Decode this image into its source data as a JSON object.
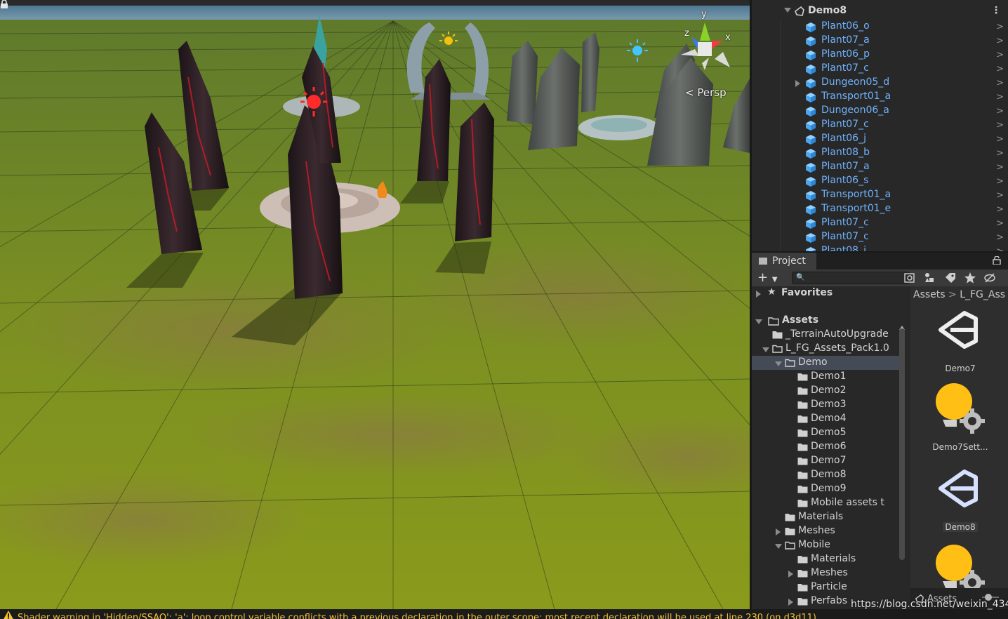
{
  "scene": {
    "view_mode": "Persp",
    "gizmo_axes": {
      "x": "x",
      "y": "y",
      "z": "z"
    }
  },
  "hierarchy": {
    "root": "Demo8",
    "items": [
      {
        "label": "Plant06_o",
        "expandable": false
      },
      {
        "label": "Plant07_a",
        "expandable": false
      },
      {
        "label": "Plant06_p",
        "expandable": false
      },
      {
        "label": "Plant07_c",
        "expandable": false
      },
      {
        "label": "Dungeon05_d",
        "expandable": true
      },
      {
        "label": "Transport01_a",
        "expandable": false
      },
      {
        "label": "Dungeon06_a",
        "expandable": false
      },
      {
        "label": "Plant07_c",
        "expandable": false
      },
      {
        "label": "Plant06_j",
        "expandable": false
      },
      {
        "label": "Plant08_b",
        "expandable": false
      },
      {
        "label": "Plant07_a",
        "expandable": false
      },
      {
        "label": "Plant06_s",
        "expandable": false
      },
      {
        "label": "Transport01_a",
        "expandable": false
      },
      {
        "label": "Transport01_e",
        "expandable": false
      },
      {
        "label": "Plant07_c",
        "expandable": false
      },
      {
        "label": "Plant07_c",
        "expandable": false
      },
      {
        "label": "Plant08_j",
        "expandable": false
      }
    ]
  },
  "project": {
    "tab_label": "Project",
    "add_label": "+",
    "favorites_label": "Favorites",
    "assets_label": "Assets",
    "tree": [
      {
        "label": "_TerrainAutoUpgrade",
        "depth": 1,
        "arrow": "none"
      },
      {
        "label": "L_FG_Assets_Pack1.0",
        "depth": 1,
        "arrow": "down"
      },
      {
        "label": "Demo",
        "depth": 2,
        "arrow": "down",
        "selected": true
      },
      {
        "label": "Demo1",
        "depth": 3,
        "arrow": "none"
      },
      {
        "label": "Demo2",
        "depth": 3,
        "arrow": "none"
      },
      {
        "label": "Demo3",
        "depth": 3,
        "arrow": "none"
      },
      {
        "label": "Demo4",
        "depth": 3,
        "arrow": "none"
      },
      {
        "label": "Demo5",
        "depth": 3,
        "arrow": "none"
      },
      {
        "label": "Demo6",
        "depth": 3,
        "arrow": "none"
      },
      {
        "label": "Demo7",
        "depth": 3,
        "arrow": "none"
      },
      {
        "label": "Demo8",
        "depth": 3,
        "arrow": "none"
      },
      {
        "label": "Demo9",
        "depth": 3,
        "arrow": "none"
      },
      {
        "label": "Mobile assets t",
        "depth": 3,
        "arrow": "none"
      },
      {
        "label": "Materials",
        "depth": 2,
        "arrow": "none"
      },
      {
        "label": "Meshes",
        "depth": 2,
        "arrow": "right"
      },
      {
        "label": "Mobile",
        "depth": 2,
        "arrow": "down"
      },
      {
        "label": "Materials",
        "depth": 3,
        "arrow": "none"
      },
      {
        "label": "Meshes",
        "depth": 3,
        "arrow": "right"
      },
      {
        "label": "Particle",
        "depth": 3,
        "arrow": "none"
      },
      {
        "label": "Perfabs",
        "depth": 3,
        "arrow": "right"
      }
    ],
    "breadcrumb": [
      "Assets",
      "L_FG_Ass"
    ],
    "grid": [
      {
        "label": "Demo7",
        "kind": "scene"
      },
      {
        "label": "Demo7Sett...",
        "kind": "settings"
      },
      {
        "label": "Demo8",
        "kind": "scene",
        "highlighted": true
      },
      {
        "label": "",
        "kind": "settings"
      }
    ],
    "footer_label": "Assets"
  },
  "console": {
    "message": "Shader warning in 'Hidden/SSAO': 'a': loop control variable conflicts with a previous declaration in the outer scope; most recent declaration will be used at line 230 (on d3d11)"
  },
  "watermark": "https://blog.csdn.net/weixin_43474701",
  "colors": {
    "hierarchy_text": "#6fb3ff",
    "warning_text": "#f2c232",
    "light_gizmo": "#f4c20d"
  }
}
